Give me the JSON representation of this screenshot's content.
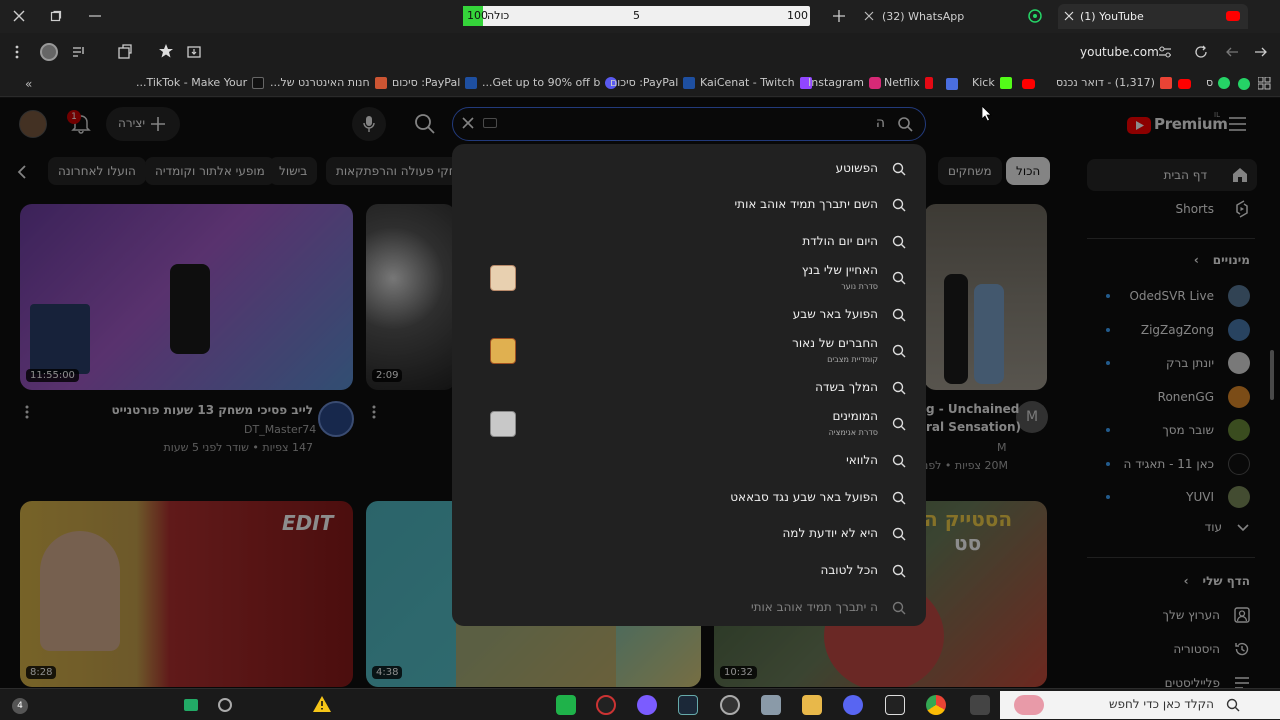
{
  "browser": {
    "tabs": [
      {
        "title": "(1) YouTube",
        "active": true
      },
      {
        "title": "(32) WhatsApp",
        "active": false
      }
    ],
    "find_bar": {
      "label": "כולה",
      "value_left": "100",
      "value_mid": "5",
      "value_right": "100"
    },
    "url": "youtube.com",
    "bookmarks": [
      {
        "label": "TikTok - Make Your..."
      },
      {
        "label": "חנות האינטרנט של..."
      },
      {
        "label": "PayPal: סיכום"
      },
      {
        "label": "Get up to 90% off b..."
      },
      {
        "label": "PayPal: סיכום"
      },
      {
        "label": "KaiCenat - Twitch"
      },
      {
        "label": "Instagram"
      },
      {
        "label": "Netflix"
      },
      {
        "label": "Kick"
      },
      {
        "label": "(1,317) - דואר נכנס"
      },
      {
        "label": "ס"
      }
    ]
  },
  "youtube": {
    "logo_text": "Premium",
    "logo_region": "IL",
    "create_label": "יצירה",
    "notification_count": "1",
    "search_query": "ה",
    "chips": [
      "הכול",
      "משחקים",
      "משחקי פעולה והרפתקאות",
      "בישול",
      "מופעי אלתור וקומדיה",
      "הועלו לאחרונה"
    ],
    "sidebar": {
      "home": "דף הבית",
      "shorts": "Shorts",
      "subscriptions_header": "מינויים",
      "subscriptions": [
        "OdedSVR Live",
        "ZigZagZong",
        "יונתן ברק",
        "RonenGG",
        "שובר מסך",
        "כאן 11 - תאגיד השי...",
        "YUVI"
      ],
      "more": "עוד",
      "you_header": "הדף שלי",
      "your_channel": "הערוץ שלך",
      "history": "היסטוריה",
      "playlists": "פלייליסטים"
    },
    "suggestions": [
      {
        "text": "הפשוטע"
      },
      {
        "text": "השם יתברך תמיד אוהב אותי"
      },
      {
        "text": "היום יום הולדת"
      },
      {
        "text": "האחיין שלי בנץ",
        "sub": "סדרת נוער"
      },
      {
        "text": "הפועל באר שבע"
      },
      {
        "text": "החברים של נאור",
        "sub": "קומדיית מצבים"
      },
      {
        "text": "המלך בשדה"
      },
      {
        "text": "המומינים",
        "sub": "סדרת אנימציה"
      },
      {
        "text": "הלוואי"
      },
      {
        "text": "הפועל באר שבע נגד סבאאט"
      },
      {
        "text": "היא לא יודעת למה"
      },
      {
        "text": "הכל לטובה"
      },
      {
        "text": "ה יתברך תמיד אוהב אותי"
      }
    ],
    "videos": [
      {
        "title": "לייב פסיכי משחק 13 שעות פורטנייט",
        "channel": "DT_Master74",
        "meta": "147 צפיות • שודר לפני 5 שעות",
        "duration": "11:55:00"
      },
      {
        "title": "g - Unchained",
        "title2": "ral Sensation)",
        "channel": "M",
        "meta": "20M צפיות • לפני",
        "duration": ""
      },
      {
        "duration": "2:09"
      },
      {
        "duration": "8:28"
      },
      {
        "duration": "4:38"
      },
      {
        "duration": "10:32"
      }
    ],
    "thumb_text_1": "EDIT",
    "thumb_text_2": "הסטייק ה",
    "thumb_text_3": "סט"
  },
  "taskbar": {
    "search_placeholder": "הקלד כאן כדי לחפש",
    "badge": "4"
  },
  "colors": {
    "yt_red": "#ff0000",
    "bg": "#0f0f0f",
    "chip_active": "#f1f1f1",
    "find_green": "#35d43a"
  }
}
